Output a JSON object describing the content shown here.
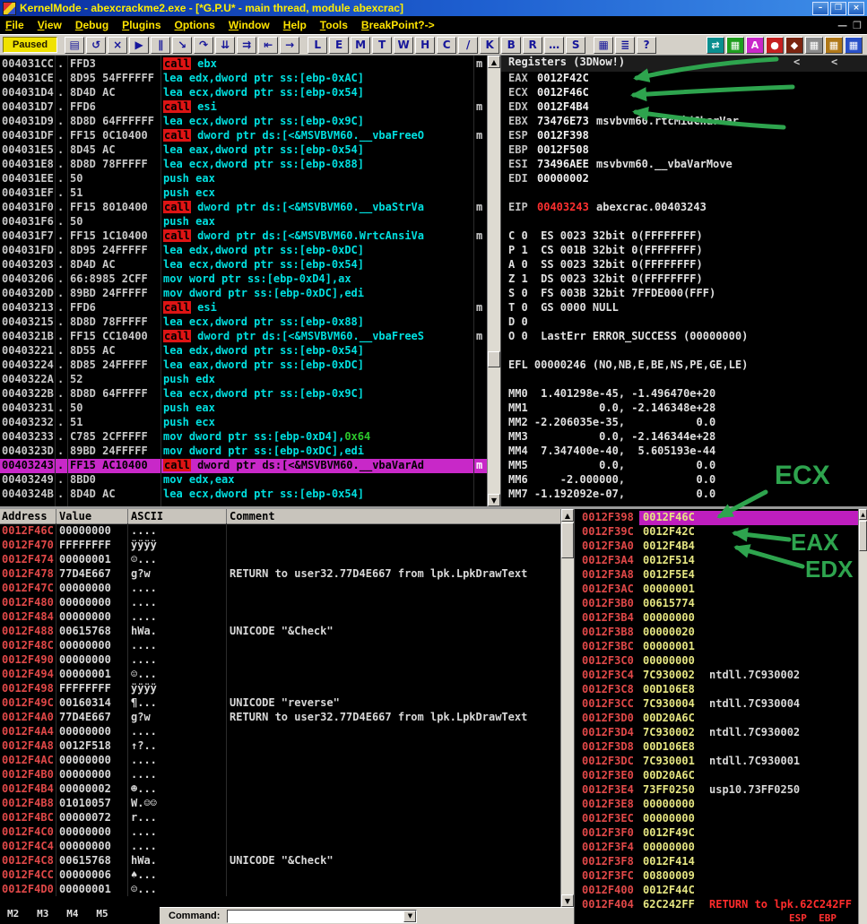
{
  "window": {
    "title": "KernelMode - abexcrackme2.exe - [*G.P.U* - main thread, module abexcrac]",
    "controls": {
      "minimize": "–",
      "maximize": "❒",
      "close": "×"
    }
  },
  "menu": {
    "items": [
      "File",
      "View",
      "Debug",
      "Plugins",
      "Options",
      "Window",
      "Help",
      "Tools",
      "BreakPoint?->"
    ],
    "mdi_buttons": [
      "—",
      "❒"
    ]
  },
  "toolbar": {
    "status": "Paused",
    "buttons": [
      {
        "name": "open-file-button",
        "glyph": "▤"
      },
      {
        "name": "restart-button",
        "glyph": "↺"
      },
      {
        "name": "close-process-button",
        "glyph": "×"
      },
      {
        "name": "run-button",
        "glyph": "▶"
      },
      {
        "name": "pause-button",
        "glyph": "∥"
      },
      {
        "name": "step-into-button",
        "glyph": "↘"
      },
      {
        "name": "step-over-button",
        "glyph": "↷"
      },
      {
        "name": "trace-into-button",
        "glyph": "⇊"
      },
      {
        "name": "trace-over-button",
        "glyph": "⇉"
      },
      {
        "name": "until-return-button",
        "glyph": "⇤"
      },
      {
        "name": "goto-button",
        "glyph": "→"
      }
    ],
    "letters": [
      "L",
      "E",
      "M",
      "T",
      "W",
      "H",
      "C",
      "/",
      "K",
      "B",
      "R",
      "…",
      "S"
    ],
    "misc": [
      {
        "name": "windows-button",
        "glyph": "▦"
      },
      {
        "name": "list-button",
        "glyph": "≣"
      },
      {
        "name": "help-button",
        "glyph": "?"
      }
    ],
    "plugin_buttons": [
      {
        "name": "teal-swap-button",
        "glyph": "⇄",
        "bg": "#0a8f8f"
      },
      {
        "name": "green-grid-button",
        "glyph": "▦",
        "bg": "#1f9e1f"
      },
      {
        "name": "magenta-a-button",
        "glyph": "A",
        "bg": "#c928c9"
      },
      {
        "name": "red-record-button",
        "glyph": "●",
        "bg": "#c62020"
      },
      {
        "name": "maroon-button",
        "glyph": "◆",
        "bg": "#7a2410"
      },
      {
        "name": "gray-grid-button",
        "glyph": "▦",
        "bg": "#8a8a8a"
      },
      {
        "name": "amber-grid-button",
        "glyph": "▦",
        "bg": "#b07818"
      },
      {
        "name": "blue-grid-button",
        "glyph": "▦",
        "bg": "#2850c8"
      }
    ]
  },
  "disassembly": {
    "rows": [
      {
        "a": "004031CC",
        "d": ".",
        "b": "FFD3",
        "mn": "call",
        "op": "ebx",
        "c": "m"
      },
      {
        "a": "004031CE",
        "d": ".",
        "b": "8D95 54FFFFFF",
        "mn": "lea",
        "op": "edx,dword ptr ss:[ebp-0xAC]"
      },
      {
        "a": "004031D4",
        "d": ".",
        "b": "8D4D AC",
        "mn": "lea",
        "op": "ecx,dword ptr ss:[ebp-0x54]"
      },
      {
        "a": "004031D7",
        "d": ".",
        "b": "FFD6",
        "mn": "call",
        "op": "esi",
        "c": "m"
      },
      {
        "a": "004031D9",
        "d": ".",
        "b": "8D8D 64FFFFFF",
        "mn": "lea",
        "op": "ecx,dword ptr ss:[ebp-0x9C]"
      },
      {
        "a": "004031DF",
        "d": ".",
        "b": "FF15 0C10400",
        "mn": "call",
        "op": "dword ptr ds:[<&MSVBVM60.__vbaFreeO",
        "c": "m"
      },
      {
        "a": "004031E5",
        "d": ".",
        "b": "8D45 AC",
        "mn": "lea",
        "op": "eax,dword ptr ss:[ebp-0x54]"
      },
      {
        "a": "004031E8",
        "d": ".",
        "b": "8D8D 78FFFFF",
        "mn": "lea",
        "op": "ecx,dword ptr ss:[ebp-0x88]"
      },
      {
        "a": "004031EE",
        "d": ".",
        "b": "50",
        "mn": "push",
        "op": "eax"
      },
      {
        "a": "004031EF",
        "d": ".",
        "b": "51",
        "mn": "push",
        "op": "ecx"
      },
      {
        "a": "004031F0",
        "d": ".",
        "b": "FF15 8010400",
        "mn": "call",
        "op": "dword ptr ds:[<&MSVBVM60.__vbaStrVa",
        "c": "m"
      },
      {
        "a": "004031F6",
        "d": ".",
        "b": "50",
        "mn": "push",
        "op": "eax"
      },
      {
        "a": "004031F7",
        "d": ".",
        "b": "FF15 1C10400",
        "mn": "call",
        "op": "dword ptr ds:[<&MSVBVM60.WrtcAnsiVa",
        "c": "m"
      },
      {
        "a": "004031FD",
        "d": ".",
        "b": "8D95 24FFFFF",
        "mn": "lea",
        "op": "edx,dword ptr ss:[ebp-0xDC]"
      },
      {
        "a": "00403203",
        "d": ".",
        "b": "8D4D AC",
        "mn": "lea",
        "op": "ecx,dword ptr ss:[ebp-0x54]"
      },
      {
        "a": "00403206",
        "d": ".",
        "b": "66:8985 2CFF",
        "mn": "mov",
        "op": "word ptr ss:[ebp-0xD4],ax"
      },
      {
        "a": "0040320D",
        "d": ".",
        "b": "89BD 24FFFFF",
        "mn": "mov",
        "op": "dword ptr ss:[ebp-0xDC],edi"
      },
      {
        "a": "00403213",
        "d": ".",
        "b": "FFD6",
        "mn": "call",
        "op": "esi",
        "c": "m"
      },
      {
        "a": "00403215",
        "d": ".",
        "b": "8D8D 78FFFFF",
        "mn": "lea",
        "op": "ecx,dword ptr ss:[ebp-0x88]"
      },
      {
        "a": "0040321B",
        "d": ".",
        "b": "FF15 CC10400",
        "mn": "call",
        "op": "dword ptr ds:[<&MSVBVM60.__vbaFreeS",
        "c": "m"
      },
      {
        "a": "00403221",
        "d": ".",
        "b": "8D55 AC",
        "mn": "lea",
        "op": "edx,dword ptr ss:[ebp-0x54]"
      },
      {
        "a": "00403224",
        "d": ".",
        "b": "8D85 24FFFFF",
        "mn": "lea",
        "op": "eax,dword ptr ss:[ebp-0xDC]"
      },
      {
        "a": "0040322A",
        "d": ".",
        "b": "52",
        "mn": "push",
        "op": "edx"
      },
      {
        "a": "0040322B",
        "d": ".",
        "b": "8D8D 64FFFFF",
        "mn": "lea",
        "op": "ecx,dword ptr ss:[ebp-0x9C]"
      },
      {
        "a": "00403231",
        "d": ".",
        "b": "50",
        "mn": "push",
        "op": "eax"
      },
      {
        "a": "00403232",
        "d": ".",
        "b": "51",
        "mn": "push",
        "op": "ecx"
      },
      {
        "a": "00403233",
        "d": ".",
        "b": "C785 2CFFFFF",
        "mn": "mov",
        "op": "dword ptr ss:[ebp-0xD4],",
        "imm": "0x64"
      },
      {
        "a": "0040323D",
        "d": ".",
        "b": "89BD 24FFFFF",
        "mn": "mov",
        "op": "dword ptr ss:[ebp-0xDC],edi"
      },
      {
        "a": "00403243",
        "d": ".",
        "b": "FF15 AC10400",
        "mn": "call",
        "op": "dword ptr ds:[<&MSVBVM60.__vbaVarAd",
        "c": "m",
        "hl": true
      },
      {
        "a": "00403249",
        "d": ".",
        "b": "8BD0",
        "mn": "mov",
        "op": "edx,eax"
      },
      {
        "a": "0040324B",
        "d": ".",
        "b": "8D4D AC",
        "mn": "lea",
        "op": "ecx,dword ptr ss:[ebp-0x54]"
      }
    ]
  },
  "registers": {
    "header": "Registers (3DNow!)",
    "pager": "<",
    "gpr": [
      {
        "name": "EAX",
        "value": "0012F42C"
      },
      {
        "name": "ECX",
        "value": "0012F46C"
      },
      {
        "name": "EDX",
        "value": "0012F4B4"
      },
      {
        "name": "EBX",
        "value": "73476E73",
        "comment": "msvbvm60.rtcMidCharVar"
      },
      {
        "name": "ESP",
        "value": "0012F398"
      },
      {
        "name": "EBP",
        "value": "0012F508"
      },
      {
        "name": "ESI",
        "value": "73496AEE",
        "comment": "msvbvm60.__vbaVarMove"
      },
      {
        "name": "EDI",
        "value": "00000002"
      }
    ],
    "eip": {
      "name": "EIP",
      "value": "00403243",
      "comment": "abexcrac.00403243"
    },
    "flags": [
      "C 0  ES 0023 32bit 0(FFFFFFFF)",
      "P 1  CS 001B 32bit 0(FFFFFFFF)",
      "A 0  SS 0023 32bit 0(FFFFFFFF)",
      "Z 1  DS 0023 32bit 0(FFFFFFFF)",
      "S 0  FS 003B 32bit 7FFDE000(FFF)",
      "T 0  GS 0000 NULL",
      "D 0",
      "O 0  LastErr ERROR_SUCCESS (00000000)"
    ],
    "efl": "EFL 00000246 (NO,NB,E,BE,NS,PE,GE,LE)",
    "mmx": [
      "MM0  1.401298e-45, -1.496470e+20",
      "MM1           0.0, -2.146348e+28",
      "MM2 -2.206035e-35,           0.0",
      "MM3           0.0, -2.146344e+28",
      "MM4  7.347400e-40,  5.605193e-44",
      "MM5           0.0,           0.0",
      "MM6     -2.000000,           0.0",
      "MM7 -1.192092e-07,           0.0"
    ]
  },
  "dump": {
    "headers": [
      "Address",
      "Value",
      "ASCII",
      "Comment"
    ],
    "rows": [
      [
        "0012F46C",
        "00000000",
        "....",
        ""
      ],
      [
        "0012F470",
        "FFFFFFFF",
        "ÿÿÿÿ",
        ""
      ],
      [
        "0012F474",
        "00000001",
        "☺...",
        ""
      ],
      [
        "0012F478",
        "77D4E667",
        "g?w",
        "RETURN to user32.77D4E667 from lpk.LpkDrawText"
      ],
      [
        "0012F47C",
        "00000000",
        "....",
        ""
      ],
      [
        "0012F480",
        "00000000",
        "....",
        ""
      ],
      [
        "0012F484",
        "00000000",
        "....",
        ""
      ],
      [
        "0012F488",
        "00615768",
        "hWa.",
        "UNICODE \"&Check\""
      ],
      [
        "0012F48C",
        "00000000",
        "....",
        ""
      ],
      [
        "0012F490",
        "00000000",
        "....",
        ""
      ],
      [
        "0012F494",
        "00000001",
        "☺...",
        ""
      ],
      [
        "0012F498",
        "FFFFFFFF",
        "ÿÿÿÿ",
        ""
      ],
      [
        "0012F49C",
        "00160314",
        "¶...",
        "UNICODE \"reverse\""
      ],
      [
        "0012F4A0",
        "77D4E667",
        "g?w",
        "RETURN to user32.77D4E667 from lpk.LpkDrawText"
      ],
      [
        "0012F4A4",
        "00000000",
        "....",
        ""
      ],
      [
        "0012F4A8",
        "0012F518",
        "↑?..",
        ""
      ],
      [
        "0012F4AC",
        "00000000",
        "....",
        ""
      ],
      [
        "0012F4B0",
        "00000000",
        "....",
        ""
      ],
      [
        "0012F4B4",
        "00000002",
        "☻...",
        ""
      ],
      [
        "0012F4B8",
        "01010057",
        "W.☺☺",
        ""
      ],
      [
        "0012F4BC",
        "00000072",
        "r...",
        ""
      ],
      [
        "0012F4C0",
        "00000000",
        "....",
        ""
      ],
      [
        "0012F4C4",
        "00000000",
        "....",
        ""
      ],
      [
        "0012F4C8",
        "00615768",
        "hWa.",
        "UNICODE \"&Check\""
      ],
      [
        "0012F4CC",
        "00000006",
        "♠...",
        ""
      ],
      [
        "0012F4D0",
        "00000001",
        "☺...",
        ""
      ]
    ]
  },
  "stack": {
    "rows": [
      {
        "a": "0012F398",
        "v": "0012F46C",
        "c": "",
        "hl": true
      },
      {
        "a": "0012F39C",
        "v": "0012F42C",
        "c": ""
      },
      {
        "a": "0012F3A0",
        "v": "0012F4B4",
        "c": ""
      },
      {
        "a": "0012F3A4",
        "v": "0012F514",
        "c": ""
      },
      {
        "a": "0012F3A8",
        "v": "0012F5E4",
        "c": ""
      },
      {
        "a": "0012F3AC",
        "v": "00000001",
        "c": ""
      },
      {
        "a": "0012F3B0",
        "v": "00615774",
        "c": ""
      },
      {
        "a": "0012F3B4",
        "v": "00000000",
        "c": ""
      },
      {
        "a": "0012F3B8",
        "v": "00000020",
        "c": ""
      },
      {
        "a": "0012F3BC",
        "v": "00000001",
        "c": ""
      },
      {
        "a": "0012F3C0",
        "v": "00000000",
        "c": ""
      },
      {
        "a": "0012F3C4",
        "v": "7C930002",
        "c": "ntdll.7C930002"
      },
      {
        "a": "0012F3C8",
        "v": "00D106E8",
        "c": ""
      },
      {
        "a": "0012F3CC",
        "v": "7C930004",
        "c": "ntdll.7C930004"
      },
      {
        "a": "0012F3D0",
        "v": "00D20A6C",
        "c": ""
      },
      {
        "a": "0012F3D4",
        "v": "7C930002",
        "c": "ntdll.7C930002"
      },
      {
        "a": "0012F3D8",
        "v": "00D106E8",
        "c": ""
      },
      {
        "a": "0012F3DC",
        "v": "7C930001",
        "c": "ntdll.7C930001"
      },
      {
        "a": "0012F3E0",
        "v": "00D20A6C",
        "c": ""
      },
      {
        "a": "0012F3E4",
        "v": "73FF0250",
        "c": "usp10.73FF0250"
      },
      {
        "a": "0012F3E8",
        "v": "00000000",
        "c": ""
      },
      {
        "a": "0012F3EC",
        "v": "00000000",
        "c": ""
      },
      {
        "a": "0012F3F0",
        "v": "0012F49C",
        "c": ""
      },
      {
        "a": "0012F3F4",
        "v": "00000000",
        "c": ""
      },
      {
        "a": "0012F3F8",
        "v": "0012F414",
        "c": ""
      },
      {
        "a": "0012F3FC",
        "v": "00800009",
        "c": ""
      },
      {
        "a": "0012F400",
        "v": "0012F44C",
        "c": ""
      },
      {
        "a": "0012F404",
        "v": "62C242FF",
        "c": "RETURN to lpk.62C242FF",
        "red": true
      }
    ]
  },
  "bottom": {
    "bookmarks": "M2   M3   M4   M5",
    "command_label": "Command:",
    "command_value": "",
    "status_right": "ESP  EBP"
  },
  "annotations": {
    "color": "#2ea44e",
    "labels": {
      "big": "ECX",
      "mid": "EAX",
      "low": "EDX"
    }
  },
  "icons": {
    "up": "▲",
    "down": "▼",
    "dropdown": "▼"
  }
}
